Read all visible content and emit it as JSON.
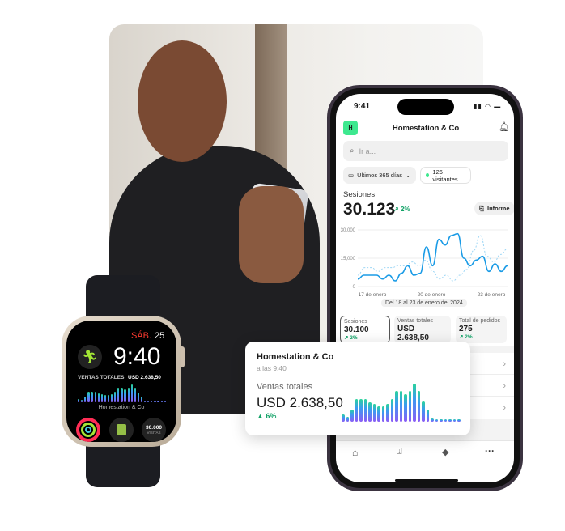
{
  "phone": {
    "status_time": "9:41",
    "store_initial": "H",
    "store_name": "Homestation & Co",
    "search_placeholder": "Ir a...",
    "date_filter": "Últimos 365 días",
    "visitors": "126 visitantes",
    "metric_title": "Sesiones",
    "metric_value": "30.123",
    "metric_change": "2%",
    "report_button": "Informe",
    "date_range": "Del 18 al 23 de enero del 2024",
    "cards": [
      {
        "label": "Sesiones",
        "value": "30.100",
        "change": "2%"
      },
      {
        "label": "Ventas totales",
        "value": "USD 2.638,50",
        "change": "12%"
      },
      {
        "label": "Total de pedidos",
        "value": "275",
        "change": "2%"
      }
    ],
    "tabs": [
      "home-icon",
      "orders-icon",
      "tag-icon",
      "more-icon"
    ],
    "accent": "#12a267",
    "logo_color": "#3ee88f"
  },
  "chart_data": {
    "type": "line",
    "ylim": [
      0,
      30000
    ],
    "y_ticks": [
      "30,000",
      "15,000",
      "0"
    ],
    "x_ticks": [
      "17 de enero",
      "20 de enero",
      "23 de enero"
    ],
    "series": [
      {
        "style": "solid",
        "color": "#1a9be6",
        "values": [
          4000,
          6000,
          6000,
          6000,
          4000,
          6000,
          3000,
          7000,
          11000,
          6000,
          7000,
          21000,
          11000,
          25000,
          22000,
          27000,
          28000,
          15000,
          11000,
          14000,
          16000,
          8000,
          12000,
          8000,
          11000
        ]
      },
      {
        "style": "dashed",
        "color": "#9dd6f5",
        "values": [
          6000,
          10000,
          10000,
          8000,
          10000,
          10000,
          11000,
          11000,
          13000,
          11000,
          14000,
          8000,
          4000,
          6000,
          3000,
          6000,
          9000,
          19000,
          27000,
          16000,
          13000,
          17000,
          20000
        ]
      }
    ]
  },
  "watch": {
    "day": "SÁB.",
    "date": "25",
    "time": "9:40",
    "metric_label": "VENTAS TOTALES",
    "metric_value": "USD 2.638,50",
    "store_name": "Homestation & Co",
    "visits_value": "30.000",
    "visits_label": "VISITAS"
  },
  "widget": {
    "store_name": "Homestation & Co",
    "time": "a las 9:40",
    "metric_label": "Ventas totales",
    "metric_value": "USD 2.638,50",
    "change": "6%",
    "bars": [
      26,
      18,
      46,
      82,
      82,
      82,
      72,
      65,
      56,
      56,
      65,
      82,
      112,
      112,
      100,
      112,
      140,
      112,
      75,
      46,
      12,
      10,
      10,
      10,
      10,
      10,
      10
    ]
  }
}
